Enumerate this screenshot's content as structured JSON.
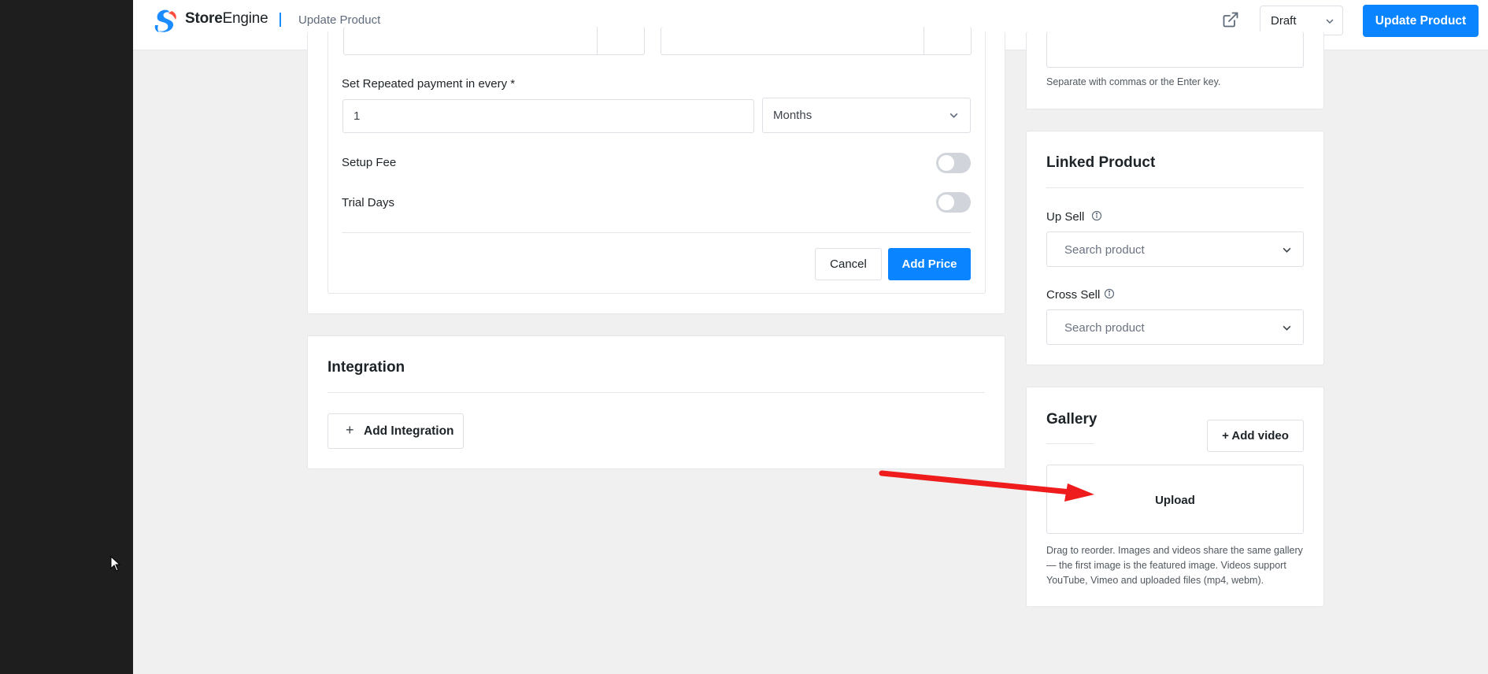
{
  "header": {
    "brand_bold": "Store",
    "brand_light": "Engine",
    "page_label": "Update Product",
    "external_link_icon": "external-link-icon",
    "status_value": "Draft",
    "update_button": "Update Product"
  },
  "pricing_form": {
    "repeat_label": "Set Repeated payment in every *",
    "repeat_value": "1",
    "interval_value": "Months",
    "setup_fee_label": "Setup Fee",
    "setup_fee_enabled": false,
    "trial_days_label": "Trial Days",
    "trial_days_enabled": false,
    "cancel_button": "Cancel",
    "add_price_button": "Add Price"
  },
  "integration": {
    "title": "Integration",
    "add_button_icon": "+",
    "add_button": "Add Integration"
  },
  "tags": {
    "help": "Separate with commas or the Enter key."
  },
  "linked_product": {
    "title": "Linked Product",
    "up_sell_label": "Up Sell",
    "up_sell_placeholder": "Search product",
    "cross_sell_label": "Cross Sell",
    "cross_sell_placeholder": "Search product"
  },
  "gallery": {
    "title": "Gallery",
    "add_video_button": "+ Add video",
    "upload_label": "Upload",
    "help_line1": "Drag to reorder. Images and videos share the same gallery",
    "help_line2": "— the first image is the featured image. Videos support",
    "help_line3": "YouTube, Vimeo and uploaded files (mp4, webm)."
  },
  "colors": {
    "primary": "#0a84ff",
    "annotation_arrow": "#ee1c1c",
    "left_rail": "#1e1e1e",
    "page_background": "#f0f0f1"
  }
}
